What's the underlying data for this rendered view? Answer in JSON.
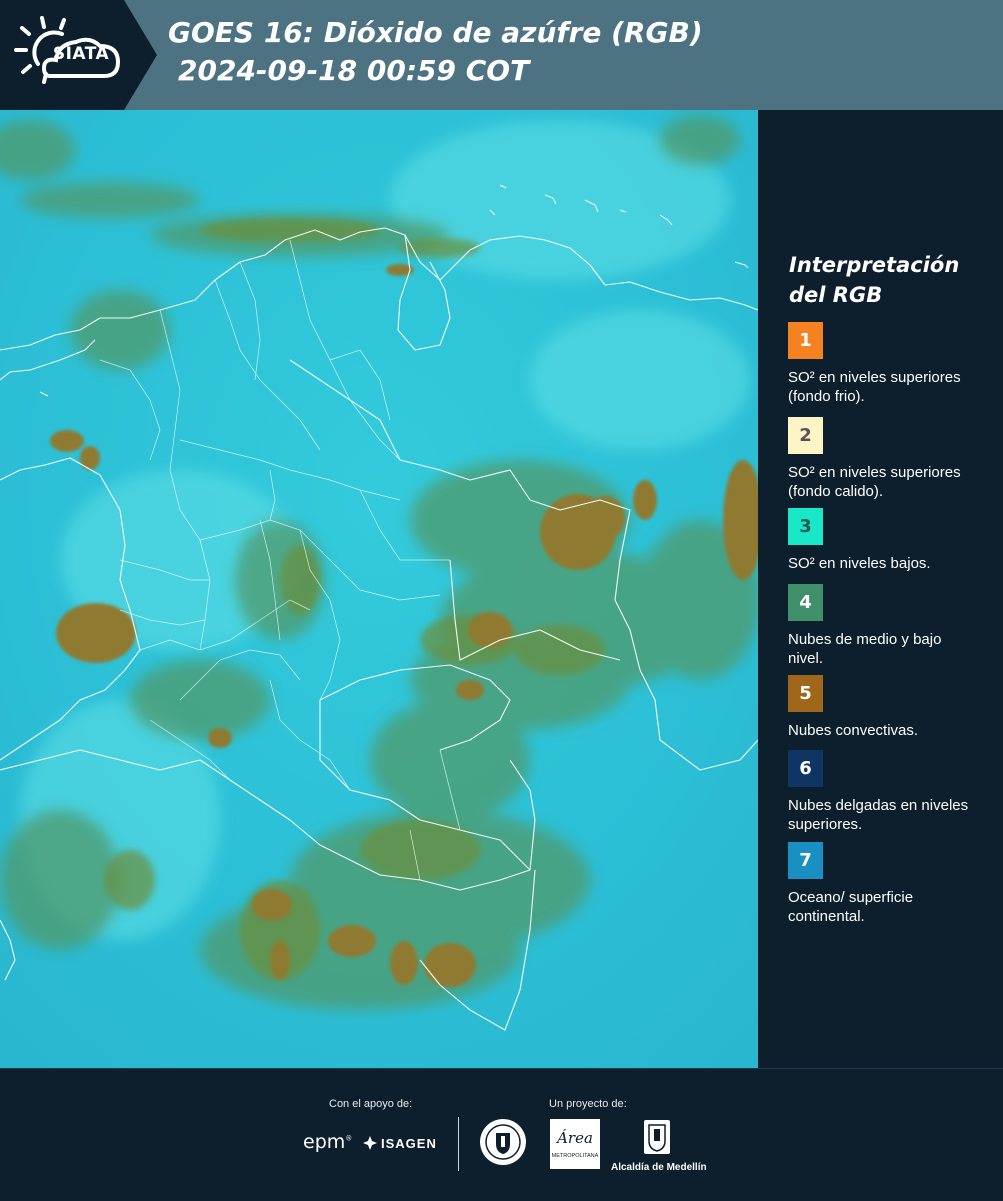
{
  "header": {
    "logo_text": "SIATA",
    "title_line1": "GOES 16: Dióxido de azúfre (RGB)",
    "title_line2": "2024-09-18 00:59 COT"
  },
  "colors": {
    "header_bg": "#4d7282",
    "panel_bg": "#0d1f2c",
    "map_background": "#2fc3d8"
  },
  "legend": {
    "title_line1": "Interpretación",
    "title_line2": "del RGB",
    "items": [
      {
        "number": "1",
        "label": "SO² en niveles superiores (fondo frio).",
        "color": "#f58220",
        "text_color": "#ffffff"
      },
      {
        "number": "2",
        "label": "SO² en niveles superiores (fondo calido).",
        "color": "#fef5c6",
        "text_color": "#555555"
      },
      {
        "number": "3",
        "label": "SO² en niveles bajos.",
        "color": "#19e8c8",
        "text_color": "#1b5e55"
      },
      {
        "number": "4",
        "label": "Nubes de medio y bajo nivel.",
        "color": "#3f8f6a",
        "text_color": "#ffffff"
      },
      {
        "number": "5",
        "label": "Nubes convectivas.",
        "color": "#a0661a",
        "text_color": "#ffffff"
      },
      {
        "number": "6",
        "label": "Nubes delgadas en niveles superiores.",
        "color": "#0e3564",
        "text_color": "#ffffff"
      },
      {
        "number": "7",
        "label": "Oceano/ superficie continental.",
        "color": "#1a8fc2",
        "text_color": "#ffffff"
      }
    ]
  },
  "footer": {
    "support_label": "Con el apoyo de:",
    "project_label": "Un proyecto de:",
    "epm_text": "epm",
    "isagen_text": "ISAGEN",
    "area_text": "Área",
    "area_subtext": "METROPOLITANA",
    "alcaldia_text": "Alcaldía de Medellín"
  }
}
